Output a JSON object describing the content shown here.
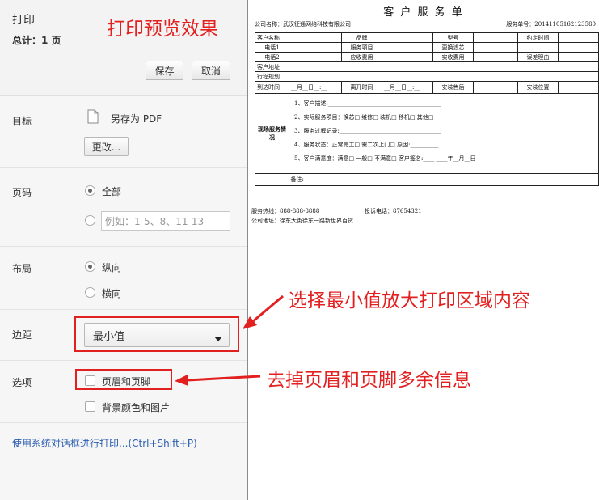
{
  "sidebar": {
    "title": "打印",
    "total": "总计：1 页",
    "save_label": "保存",
    "cancel_label": "取消",
    "destination": {
      "label": "目标",
      "value": "另存为 PDF",
      "change_label": "更改..."
    },
    "pages": {
      "label": "页码",
      "all_label": "全部",
      "custom_placeholder": "例如：1-5、8、11-13"
    },
    "layout": {
      "label": "布局",
      "portrait_label": "纵向",
      "landscape_label": "横向"
    },
    "margins": {
      "label": "边距",
      "value": "最小值"
    },
    "options": {
      "label": "选项",
      "header_footer_label": "页眉和页脚",
      "background_label": "背景颜色和图片"
    },
    "system_dialog_link": "使用系统对话框进行打印...(Ctrl+Shift+P)"
  },
  "annotations": {
    "preview_title": "打印预览效果",
    "margin_note": "选择最小值放大打印区域内容",
    "header_note": "去掉页眉和页脚多余信息"
  },
  "document": {
    "title": "客 户 服 务 单",
    "company_line": "公司名称：武汉征通网络科技有限公司",
    "service_no": "服务单号：20141105162123580",
    "rows": {
      "r1": [
        "客户名称",
        "",
        "品牌",
        "",
        "型号",
        "",
        "约定时间",
        ""
      ],
      "r2": [
        "电话1",
        "",
        "服务项目",
        "",
        "更换滤芯",
        "",
        "",
        ""
      ],
      "r3": [
        "电话2",
        "",
        "应收费用",
        "",
        "实收费用",
        "",
        "误差理由",
        ""
      ],
      "r4": [
        "客户地址"
      ],
      "r5": [
        "行程规划"
      ],
      "r6": [
        "到达时间",
        "__月__日__:__",
        "离开时间",
        "__月__日__:__",
        "安装售后",
        "",
        "安装位置",
        ""
      ]
    },
    "section_label": "现场服务情况",
    "lines": [
      "1、客户描述:________________________________________",
      "2、实际服务项目：换芯□  维修□  装机□  移机□  其他□",
      "3、服务过程记录:____________________________________",
      "4、服务状态：正常完工□  需二次上门□  原因:__________",
      "5、客户满意度：满意□  一般□  不满意□     客户签名:____   ____年__月__日"
    ],
    "remark_label": "备注:",
    "hotline": "服务热线：888-888-8888",
    "complaint": "投诉电话：87654321",
    "address": "公司地址：徐东大街徐东一路新世界百货"
  }
}
